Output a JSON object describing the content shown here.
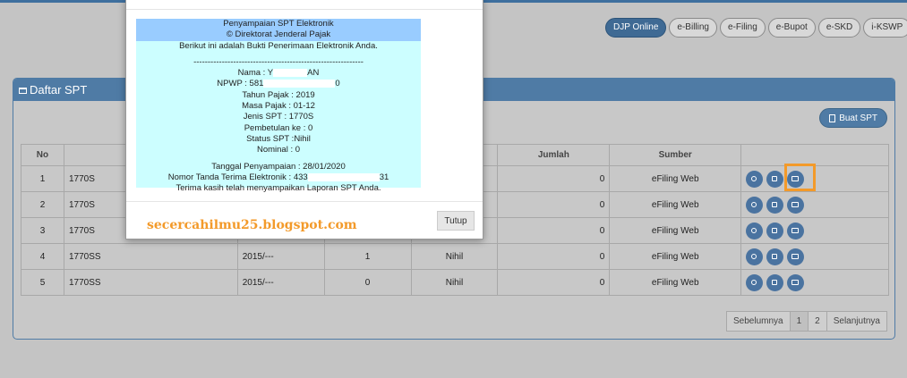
{
  "nav": [
    "DJP Online",
    "e-Billing",
    "e-Filing",
    "e-Bupot",
    "e-SKD",
    "i-KSWP"
  ],
  "panel": {
    "title": "Daftar SPT",
    "create_button": "Buat SPT"
  },
  "table": {
    "headers": [
      "No",
      "",
      "",
      "",
      "",
      "Jumlah",
      "Sumber",
      ""
    ],
    "rows": [
      [
        "1",
        "1770S",
        "",
        "",
        "",
        "0",
        "eFiling Web"
      ],
      [
        "2",
        "1770S",
        "",
        "",
        "",
        "0",
        "eFiling Web"
      ],
      [
        "3",
        "1770S",
        "",
        "",
        "",
        "0",
        "eFiling Web"
      ],
      [
        "4",
        "1770SS",
        "2015/---",
        "1",
        "Nihil",
        "0",
        "eFiling Web"
      ],
      [
        "5",
        "1770SS",
        "2015/---",
        "0",
        "Nihil",
        "0",
        "eFiling Web"
      ]
    ]
  },
  "pagination": {
    "prev": "Sebelumnya",
    "pages": [
      "1",
      "2"
    ],
    "next": "Selanjutnya"
  },
  "receipt": {
    "title": "Penyampaian SPT Elektronik",
    "copyright": "© Direktorat Jenderal Pajak",
    "intro": "Berikut ini adalah Bukti Penerimaan Elektronik Anda.",
    "separator": "------------------------------------------------------------",
    "nama_label": "Nama : Y",
    "nama_suffix": "AN",
    "npwp_label": "NPWP : 581",
    "npwp_suffix": "0",
    "tahun_pajak": "Tahun Pajak : 2019",
    "masa_pajak": "Masa Pajak : 01-12",
    "jenis_spt": "Jenis SPT : 1770S",
    "pembetulan": "Pembetulan ke : 0",
    "status_spt": "Status SPT :Nihil",
    "nominal": "Nominal : 0",
    "tanggal": "Tanggal Penyampaian : 28/01/2020",
    "ntte_label": "Nomor Tanda Terima Elektronik : 433",
    "ntte_suffix": "31",
    "thanks": "Terima kasih telah menyampaikan Laporan SPT Anda."
  },
  "modal": {
    "watermark": "secercahilmu25.blogspot.com",
    "close_button": "Tutup"
  },
  "colors": {
    "header_blue": "#4f7ba5",
    "receipt_bg": "#ccfeff",
    "receipt_head": "#99ccff",
    "highlight": "#f39a2a"
  }
}
